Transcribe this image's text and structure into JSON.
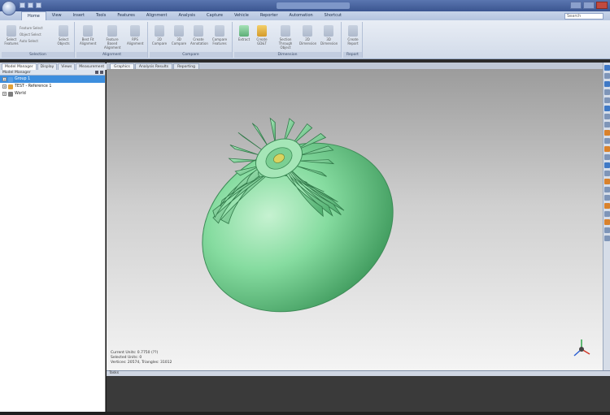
{
  "window": {
    "title": "",
    "help_search_placeholder": "Search"
  },
  "ribbon": {
    "tabs": [
      "Home",
      "View",
      "Insert",
      "Tools",
      "Features",
      "Alignment",
      "Analysis",
      "Capture",
      "Vehicle",
      "Reporter",
      "Automation",
      "Shortcut"
    ],
    "active_tab": "Home",
    "groups": [
      {
        "label": "Selection",
        "buttons": [
          "Select Features",
          "Select Objects"
        ],
        "small_items": [
          "Feature Select",
          "Object Select",
          "Auto Select"
        ]
      },
      {
        "label": "Alignment",
        "buttons": [
          "Best Fit Alignment",
          "Feature Based Alignment",
          "RPS Alignment"
        ]
      },
      {
        "label": "Compare",
        "buttons": [
          "2D Compare",
          "3D Compare",
          "Create Annotation",
          "Compare Features"
        ]
      },
      {
        "label": "Dimension",
        "buttons": [
          "Extract",
          "Create GD&T",
          "Section Through Object",
          "2D Dimension",
          "3D Dimension"
        ]
      },
      {
        "label": "Report",
        "buttons": [
          "Create Report"
        ]
      }
    ]
  },
  "left_panel": {
    "tabs": [
      "Model Manager",
      "Display",
      "Views",
      "Measurement"
    ],
    "active_tab": "Model Manager",
    "title": "Model Manager",
    "tree": [
      {
        "label": "Group 1",
        "selected": true
      },
      {
        "label": "TEST - Reference 1",
        "selected": false
      },
      {
        "label": "World",
        "selected": false
      }
    ]
  },
  "viewport": {
    "tabs": [
      "Graphics",
      "Analysis Results",
      "Reporting"
    ],
    "active_tab": "Graphics",
    "info_lines": [
      "Current Units: 0.7750 (??)",
      "Selected Units: 0",
      "Vertices: 20574, Triangles: 31012"
    ]
  },
  "bottom_panel": {
    "label": "Tasks"
  },
  "colors": {
    "model": "#7ed99a",
    "selection": "#3d8ede",
    "ribbon": "#dde4ef"
  }
}
